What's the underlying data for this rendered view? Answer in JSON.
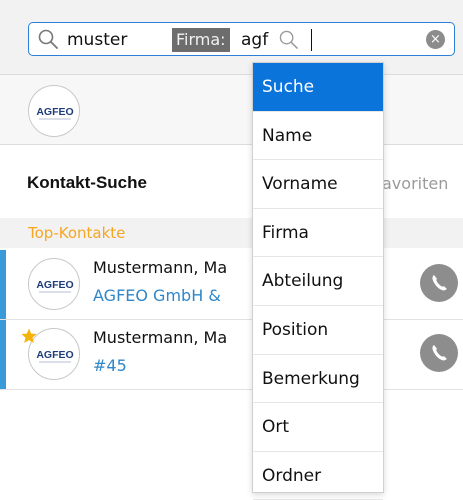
{
  "search": {
    "term": "muster",
    "chip": "Firma:",
    "term2": "agf",
    "clear_icon": "×"
  },
  "logo": {
    "text": "AGFEO"
  },
  "header": {
    "title": "Kontakt-Suche",
    "favorites_tab": "avoriten"
  },
  "section": {
    "label": "Top-Kontakte"
  },
  "contacts": [
    {
      "name": "Mustermann, Ma",
      "subtitle": "AGFEO GmbH &",
      "starred": false
    },
    {
      "name": "Mustermann, Ma",
      "subtitle": "#45",
      "starred": true
    }
  ],
  "dropdown": {
    "items": [
      "Suche",
      "Name",
      "Vorname",
      "Firma",
      "Abteilung",
      "Position",
      "Bemerkung",
      "Ort",
      "Ordner"
    ],
    "selected": "Suche"
  },
  "colors": {
    "accent": "#0a74da",
    "row_accent": "#3a9ad9",
    "section_label": "#f5a623",
    "link": "#2f86c8"
  }
}
